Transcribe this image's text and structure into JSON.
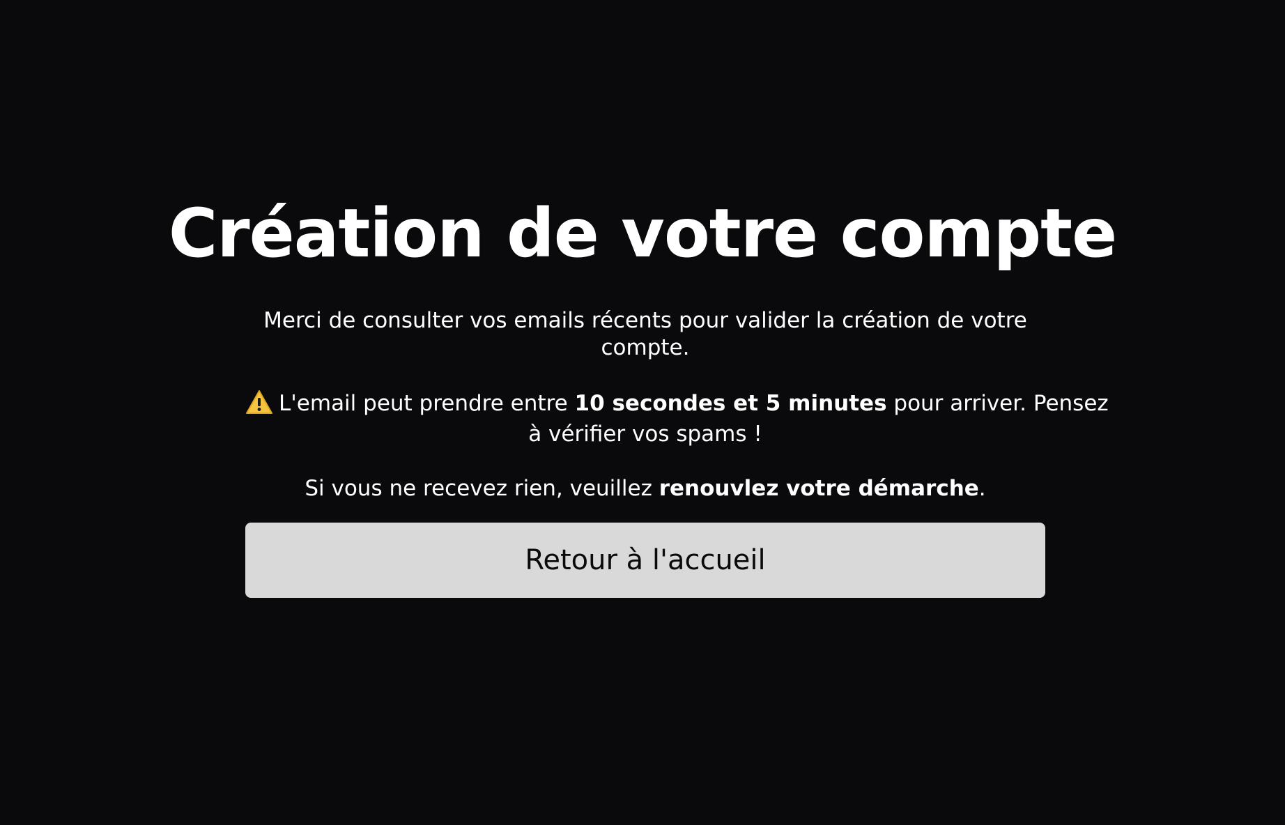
{
  "page": {
    "title": "Création de votre compte"
  },
  "message": {
    "line1": "Merci de consulter vos emails récents pour valider la création de votre",
    "line1_end": "compte.",
    "warning_prefix": "L'email peut prendre entre ",
    "warning_bold": "10 secondes et 5 minutes",
    "warning_suffix": " pour arriver. Pensez",
    "warning_end": "à vérifier vos spams !",
    "retry_prefix": "Si vous ne recevez rien, veuillez ",
    "retry_bold": "renouvlez votre démarche",
    "retry_suffix": "."
  },
  "icons": {
    "warning": "warning-icon"
  },
  "colors": {
    "background": "#0a0a0c",
    "text": "#ffffff",
    "button_background": "#d9d9d9",
    "button_text": "#0a0a0c",
    "warning_icon": "#f5c542"
  },
  "actions": {
    "home_button_label": "Retour à l'accueil"
  }
}
